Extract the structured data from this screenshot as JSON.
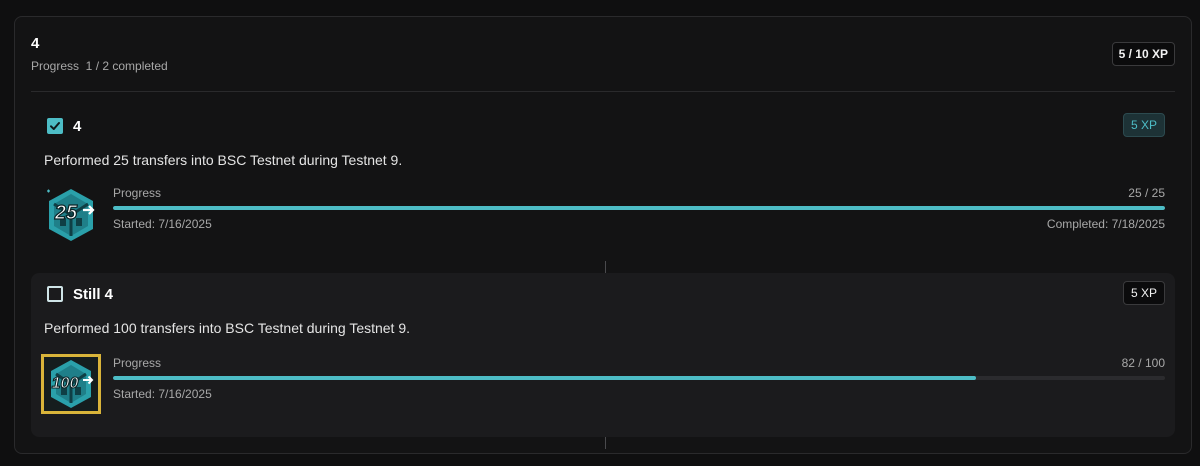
{
  "header": {
    "title": "4",
    "progress_text": "Progress  1 / 2 completed",
    "xp_badge": "5 / 10 XP"
  },
  "quests": [
    {
      "title": "4",
      "xp": "5 XP",
      "completed": true,
      "description": "Performed 25 transfers into BSC Testnet during Testnet 9.",
      "badge_text": "25",
      "progress_label": "Progress",
      "progress_count": "25 / 25",
      "progress_fraction": 1.0,
      "started": "Started: 7/16/2025",
      "completed_text": "Completed: 7/18/2025"
    },
    {
      "title": "Still 4",
      "xp": "5 XP",
      "completed": false,
      "description": "Performed 100 transfers into BSC Testnet during Testnet 9.",
      "badge_text": "100",
      "progress_label": "Progress",
      "progress_count": "82 / 100",
      "progress_fraction": 0.82,
      "started": "Started: 7/16/2025"
    }
  ],
  "colors": {
    "accent": "#4dbdc6",
    "badge_gold": "#d9b43a"
  },
  "icons": {
    "check": "check-icon",
    "badge": "hexagon-badge-icon"
  }
}
